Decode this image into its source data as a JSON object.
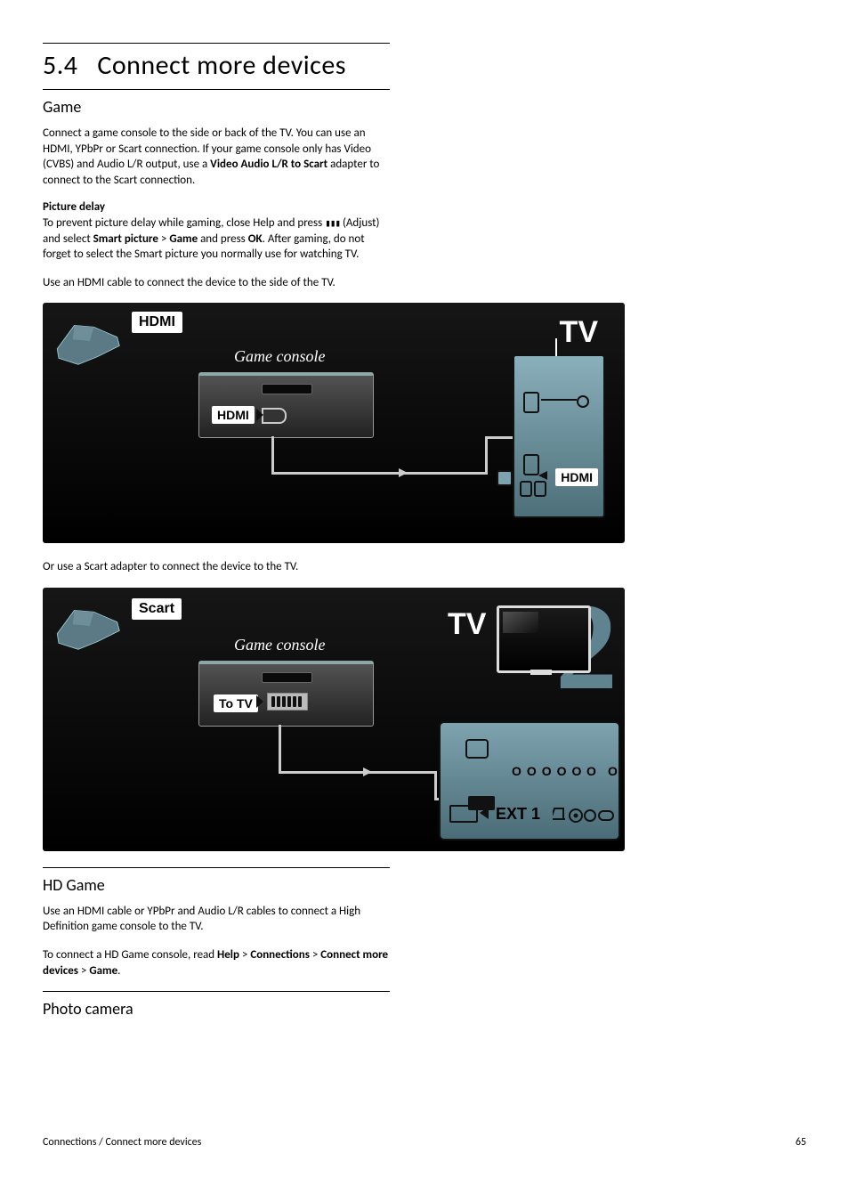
{
  "heading": {
    "number": "5.4",
    "title": "Connect more devices"
  },
  "sec_game": {
    "title": "Game",
    "p1a": "Connect a game console to the side or back of the TV. You can use an HDMI, YPbPr or Scart connection. If your game console only has Video (CVBS) and Audio L/R output, use a ",
    "p1b": "Video Audio L/R to Scart",
    "p1c": " adapter to connect to the Scart connection.",
    "sub_delay": "Picture delay",
    "p2a": "To prevent picture delay while gaming, close Help and press ",
    "p2b": " (Adjust) and select ",
    "p2c": "Smart picture",
    "p2d": " > ",
    "p2e": "Game",
    "p2f": " and press ",
    "p2g": "OK",
    "p2h": ". After gaming, do not forget to select the Smart picture you normally use for watching TV.",
    "p3": "Use an HDMI cable to connect the device to the side of the TV.",
    "p4": "Or use a Scart adapter to connect the device to the TV."
  },
  "diagram1": {
    "tag": "HDMI",
    "console_label": "Game console",
    "port_label": "HDMI",
    "tv": "TV",
    "tv_port": "HDMI"
  },
  "diagram2": {
    "tag": "Scart",
    "console_label": "Game console",
    "port_label": "To TV",
    "tv": "TV",
    "big": "2",
    "ext": "EXT 1"
  },
  "sec_hdgame": {
    "title": "HD Game",
    "p1": "Use an HDMI cable or YPbPr and Audio L/R cables to connect a High Definition game console to the TV.",
    "p2a": "To connect a HD Game console, read ",
    "p2b": "Help",
    "p2c": " > ",
    "p2d": "Connections",
    "p2e": " > ",
    "p2f": "Connect more devices",
    "p2g": " > ",
    "p2h": "Game",
    "p2i": "."
  },
  "sec_camera": {
    "title": "Photo camera"
  },
  "footer": {
    "path": "Connections / Connect more devices",
    "page": "65"
  }
}
